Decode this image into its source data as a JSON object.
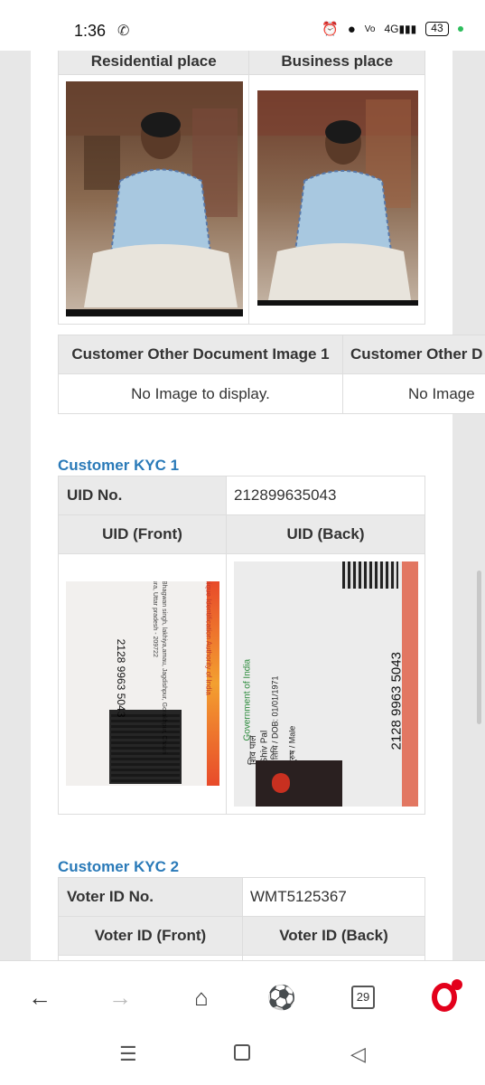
{
  "status_bar": {
    "time": "1:36",
    "battery": "43",
    "network": "4G"
  },
  "residence_table": {
    "headers": [
      "Residential place",
      "Business place"
    ]
  },
  "other_docs_table": {
    "headers": [
      "Customer Other Document Image 1",
      "Customer Other D"
    ],
    "cells": [
      "No Image to display.",
      "No Image"
    ]
  },
  "kyc1": {
    "title": "Customer KYC 1",
    "id_label": "UID No.",
    "id_value": "212899635043",
    "front_label": "UID (Front)",
    "back_label": "UID (Back)",
    "front_card": {
      "authority": "Unique Identification Authority of India",
      "address": "S/O Bhagwan singh, lakhiya,amau, Jagdishpur, Gorakhpur, Chauri Chaura, Uttar pradesh - 209722",
      "number": "2128 9963 5043"
    },
    "back_card": {
      "govt": "Government of India",
      "name_hi": "शिव पाल",
      "name": "Shiv Pal",
      "dob": "जन्म तिथि / DOB: 01/01/1971",
      "gender": "पुरुष / Male",
      "number": "2128 9963 5043"
    }
  },
  "kyc2": {
    "title": "Customer KYC 2",
    "id_label": "Voter ID No.",
    "id_value": "WMT5125367",
    "front_label": "Voter ID (Front)",
    "back_label": "Voter ID (Back)"
  },
  "browser_nav": {
    "tab_count": "29"
  },
  "colors": {
    "link_blue": "#2a7ab8",
    "header_gray": "#eaeaea",
    "opera_red": "#e3001b"
  }
}
